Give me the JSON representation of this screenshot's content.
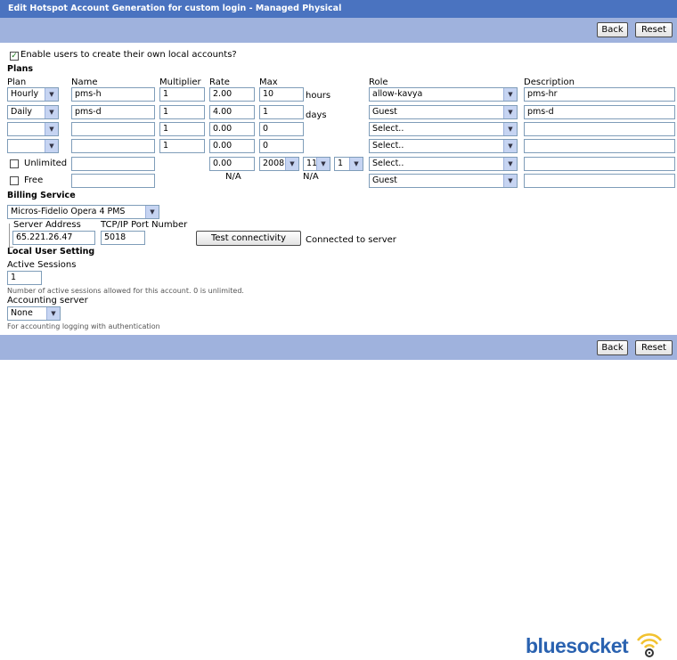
{
  "header": {
    "title": "Edit Hotspot Account Generation for custom login - Managed Physical"
  },
  "toolbar": {
    "back": "Back",
    "reset": "Reset"
  },
  "enable": {
    "label": "Enable users to create their own local accounts?",
    "checked": true
  },
  "plans": {
    "section": "Plans",
    "columns": {
      "plan": "Plan",
      "name": "Name",
      "multiplier": "Multiplier",
      "rate": "Rate",
      "max": "Max",
      "role": "Role",
      "description": "Description"
    },
    "rows": [
      {
        "plan": "Hourly",
        "name": "pms-h",
        "multiplier": "1",
        "rate": "2.00",
        "max": "10",
        "unit": "hours",
        "role": "allow-kavya",
        "description": "pms-hr"
      },
      {
        "plan": "Daily",
        "name": "pms-d",
        "multiplier": "1",
        "rate": "4.00",
        "max": "1",
        "unit": "days",
        "role": "Guest",
        "description": "pms-d"
      },
      {
        "plan": "",
        "name": "",
        "multiplier": "1",
        "rate": "0.00",
        "max": "0",
        "unit": "",
        "role": "Select..",
        "description": ""
      },
      {
        "plan": "",
        "name": "",
        "multiplier": "1",
        "rate": "0.00",
        "max": "0",
        "unit": "",
        "role": "Select..",
        "description": ""
      }
    ],
    "unlimited": {
      "label": "Unlimited",
      "rate": "0.00",
      "year": "2008",
      "month": "11",
      "day": "1",
      "role": "Select..",
      "rate_note": "N/A",
      "max_note": "N/A"
    },
    "free": {
      "label": "Free",
      "role": "Guest"
    }
  },
  "billing": {
    "section": "Billing Service",
    "service": "Micros-Fidelio Opera 4 PMS",
    "server_label": "Server Address",
    "server_value": "65.221.26.47",
    "port_label": "TCP/IP Port Number",
    "port_value": "5018",
    "test_button": "Test connectivity",
    "status": "Connected to server"
  },
  "local": {
    "section": "Local User Setting",
    "sessions_label": "Active Sessions",
    "sessions_value": "1",
    "sessions_note": "Number of active sessions allowed for this account. 0 is unlimited.",
    "accounting_label": "Accounting server",
    "accounting_value": "None",
    "accounting_note": "For accounting logging with authentication"
  },
  "brand": {
    "name": "bluesocket",
    "color": "#2a62b0",
    "accent": "#f2c230"
  }
}
